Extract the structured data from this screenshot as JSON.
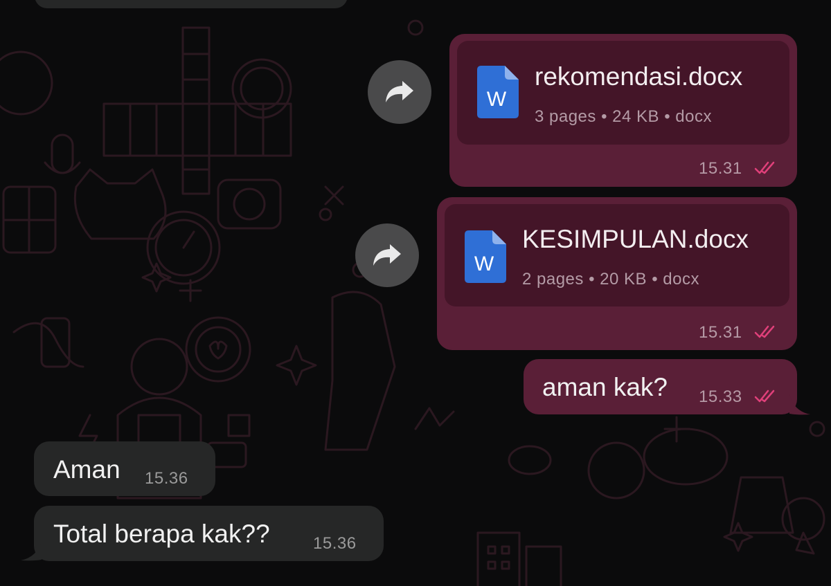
{
  "colors": {
    "outgoing_bubble": "#5a1f37",
    "document_card": "#441528",
    "incoming_bubble": "#262727",
    "read_ticks": "#e0407a",
    "forward_button": "#4a4a4b",
    "word_icon": "#2f6fd6"
  },
  "messages": [
    {
      "direction": "outgoing",
      "type": "document",
      "file_name": "rekomendasi.docx",
      "file_meta": "3 pages • 24 KB • docx",
      "time": "15.31",
      "status_icon": "double-check-icon",
      "action_icon": "forward-icon"
    },
    {
      "direction": "outgoing",
      "type": "document",
      "file_name": "KESIMPULAN.docx",
      "file_meta": "2 pages • 20 KB • docx",
      "time": "15.31",
      "status_icon": "double-check-icon",
      "action_icon": "forward-icon"
    },
    {
      "direction": "outgoing",
      "type": "text",
      "text": "aman kak?",
      "time": "15.33",
      "status_icon": "double-check-icon"
    },
    {
      "direction": "incoming",
      "type": "text",
      "text": "Aman",
      "time": "15.36"
    },
    {
      "direction": "incoming",
      "type": "text",
      "text": "Total berapa kak??",
      "time": "15.36"
    }
  ],
  "icons": {
    "word_letter": "W"
  }
}
